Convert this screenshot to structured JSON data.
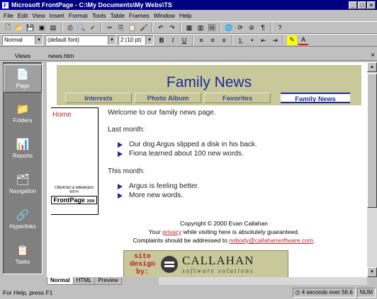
{
  "window": {
    "title": "Microsoft FrontPage - C:\\My Documents\\My Webs\\TS"
  },
  "menu": [
    "File",
    "Edit",
    "View",
    "Insert",
    "Format",
    "Tools",
    "Table",
    "Frames",
    "Window",
    "Help"
  ],
  "toolbar": {
    "style": "Normal",
    "font": "(default font)",
    "size": "2  (10 pt)"
  },
  "views": {
    "header": "Views",
    "items": [
      {
        "label": "Page",
        "icon": "page-icon",
        "selected": true
      },
      {
        "label": "Folders",
        "icon": "folder-icon"
      },
      {
        "label": "Reports",
        "icon": "reports-icon"
      },
      {
        "label": "Navigation",
        "icon": "navigation-icon"
      },
      {
        "label": "Hyperlinks",
        "icon": "hyperlinks-icon"
      },
      {
        "label": "Tasks",
        "icon": "tasks-icon"
      }
    ]
  },
  "document": {
    "tab_name": "news.htm",
    "banner_title": "Family News",
    "nav": [
      "Interests",
      "Photo Album",
      "Favorites",
      "Family News"
    ],
    "home_link": "Home",
    "fp_logo_caption": "CREATED & MANAGED WITH",
    "fp_logo_brand": "FrontPage",
    "fp_logo_year": "2000",
    "welcome": "Welcome to our family news page.",
    "last_month_heading": "Last month:",
    "last_month_items": [
      "Our dog Argus slipped a disk in his back.",
      "Fiona learned about 100 new words."
    ],
    "this_month_heading": "This month:",
    "this_month_items": [
      "Argus is feeling better.",
      "More new words."
    ],
    "copyright": "Copyright © 2000 Evan Callahan",
    "privacy_pre": "Your ",
    "privacy_link": "privacy",
    "privacy_post": " while visiting here is absolutely guaranteed.",
    "complaints_pre": "Complaints should be addressed to ",
    "complaints_email": "nobody@callahansoftware.com",
    "complaints_post": ".",
    "site_design": "site design by:",
    "brand": "CALLAHAN",
    "brand_tag": "software solutions"
  },
  "view_tabs": [
    "Normal",
    "HTML",
    "Preview"
  ],
  "status": {
    "help": "For Help, press F1",
    "timing": "4 seconds over 56.6",
    "num": "NUM"
  }
}
